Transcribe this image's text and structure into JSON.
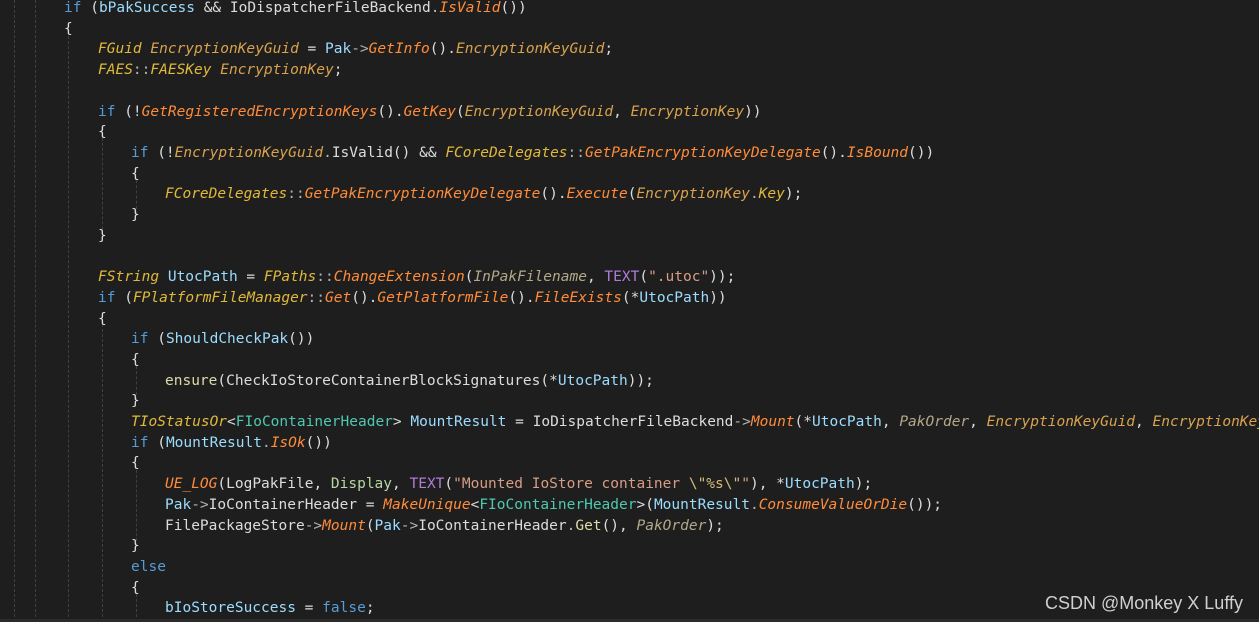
{
  "editor": {
    "lines": [
      {
        "indent": 64,
        "tokens": [
          [
            "kw",
            "if"
          ],
          [
            "plain",
            " ("
          ],
          [
            "var",
            "bPakSuccess"
          ],
          [
            "plain",
            " && "
          ],
          [
            "plain",
            "IoDispatcherFileBackend"
          ],
          [
            "op",
            "."
          ],
          [
            "fn",
            "IsValid"
          ],
          [
            "plain",
            "())"
          ]
        ]
      },
      {
        "indent": 64,
        "tokens": [
          [
            "plain",
            "{"
          ]
        ]
      },
      {
        "indent": 98,
        "tokens": [
          [
            "ty",
            "FGuid"
          ],
          [
            "plain",
            " "
          ],
          [
            "tyi",
            "EncryptionKeyGuid"
          ],
          [
            "plain",
            " = "
          ],
          [
            "var",
            "Pak"
          ],
          [
            "op",
            "->"
          ],
          [
            "fn",
            "GetInfo"
          ],
          [
            "plain",
            "()."
          ],
          [
            "tyi",
            "EncryptionKeyGuid"
          ],
          [
            "plain",
            ";"
          ]
        ]
      },
      {
        "indent": 98,
        "tokens": [
          [
            "ty",
            "FAES"
          ],
          [
            "op",
            "::"
          ],
          [
            "ty",
            "FAESKey"
          ],
          [
            "plain",
            " "
          ],
          [
            "tyi",
            "EncryptionKey"
          ],
          [
            "plain",
            ";"
          ]
        ]
      },
      {
        "indent": 98,
        "tokens": []
      },
      {
        "indent": 98,
        "tokens": [
          [
            "kw",
            "if"
          ],
          [
            "plain",
            " (!"
          ],
          [
            "fn",
            "GetRegisteredEncryptionKeys"
          ],
          [
            "plain",
            "()."
          ],
          [
            "fn",
            "GetKey"
          ],
          [
            "plain",
            "("
          ],
          [
            "tyi",
            "EncryptionKeyGuid"
          ],
          [
            "plain",
            ", "
          ],
          [
            "tyi",
            "EncryptionKey"
          ],
          [
            "plain",
            "))"
          ]
        ]
      },
      {
        "indent": 98,
        "tokens": [
          [
            "plain",
            "{"
          ]
        ]
      },
      {
        "indent": 131,
        "tokens": [
          [
            "kw",
            "if"
          ],
          [
            "plain",
            " (!"
          ],
          [
            "tyi",
            "EncryptionKeyGuid"
          ],
          [
            "op",
            "."
          ],
          [
            "plain",
            "IsValid() && "
          ],
          [
            "ty",
            "FCoreDelegates"
          ],
          [
            "op",
            "::"
          ],
          [
            "fn",
            "GetPakEncryptionKeyDelegate"
          ],
          [
            "plain",
            "()."
          ],
          [
            "fn",
            "IsBound"
          ],
          [
            "plain",
            "())"
          ]
        ]
      },
      {
        "indent": 131,
        "tokens": [
          [
            "plain",
            "{"
          ]
        ]
      },
      {
        "indent": 165,
        "tokens": [
          [
            "ty",
            "FCoreDelegates"
          ],
          [
            "op",
            "::"
          ],
          [
            "fn",
            "GetPakEncryptionKeyDelegate"
          ],
          [
            "plain",
            "()."
          ],
          [
            "fn",
            "Execute"
          ],
          [
            "plain",
            "("
          ],
          [
            "tyi",
            "EncryptionKey"
          ],
          [
            "op",
            "."
          ],
          [
            "ty",
            "Key"
          ],
          [
            "plain",
            ");"
          ]
        ]
      },
      {
        "indent": 131,
        "tokens": [
          [
            "plain",
            "}"
          ]
        ]
      },
      {
        "indent": 98,
        "tokens": [
          [
            "plain",
            "}"
          ]
        ]
      },
      {
        "indent": 98,
        "tokens": []
      },
      {
        "indent": 98,
        "tokens": [
          [
            "ty",
            "FString"
          ],
          [
            "plain",
            " "
          ],
          [
            "var",
            "UtocPath"
          ],
          [
            "plain",
            " = "
          ],
          [
            "ty",
            "FPaths"
          ],
          [
            "op",
            "::"
          ],
          [
            "fn",
            "ChangeExtension"
          ],
          [
            "plain",
            "("
          ],
          [
            "pm",
            "InPakFilename"
          ],
          [
            "plain",
            ", "
          ],
          [
            "mac",
            "TEXT"
          ],
          [
            "plain",
            "("
          ],
          [
            "str",
            "\".utoc\""
          ],
          [
            "plain",
            "));"
          ]
        ]
      },
      {
        "indent": 98,
        "tokens": [
          [
            "kw",
            "if"
          ],
          [
            "plain",
            " ("
          ],
          [
            "ty",
            "FPlatformFileManager"
          ],
          [
            "op",
            "::"
          ],
          [
            "fn",
            "Get"
          ],
          [
            "plain",
            "()."
          ],
          [
            "fn",
            "GetPlatformFile"
          ],
          [
            "plain",
            "()."
          ],
          [
            "fn",
            "FileExists"
          ],
          [
            "plain",
            "(*"
          ],
          [
            "var",
            "UtocPath"
          ],
          [
            "plain",
            "))"
          ]
        ]
      },
      {
        "indent": 98,
        "tokens": [
          [
            "plain",
            "{"
          ]
        ]
      },
      {
        "indent": 131,
        "tokens": [
          [
            "kw",
            "if"
          ],
          [
            "plain",
            " ("
          ],
          [
            "var",
            "ShouldCheckPak"
          ],
          [
            "plain",
            "())"
          ]
        ]
      },
      {
        "indent": 131,
        "tokens": [
          [
            "plain",
            "{"
          ]
        ]
      },
      {
        "indent": 165,
        "tokens": [
          [
            "fnb",
            "ensure"
          ],
          [
            "plain",
            "("
          ],
          [
            "plain",
            "CheckIoStoreContainerBlockSignatures"
          ],
          [
            "plain",
            "(*"
          ],
          [
            "var",
            "UtocPath"
          ],
          [
            "plain",
            "));"
          ]
        ]
      },
      {
        "indent": 131,
        "tokens": [
          [
            "plain",
            "}"
          ]
        ]
      },
      {
        "indent": 131,
        "tokens": [
          [
            "ty",
            "TIoStatusOr"
          ],
          [
            "plain",
            "<"
          ],
          [
            "cls",
            "FIoContainerHeader"
          ],
          [
            "plain",
            "> "
          ],
          [
            "var",
            "MountResult"
          ],
          [
            "plain",
            " = "
          ],
          [
            "plain",
            "IoDispatcherFileBackend"
          ],
          [
            "op",
            "->"
          ],
          [
            "fn",
            "Mount"
          ],
          [
            "plain",
            "(*"
          ],
          [
            "var",
            "UtocPath"
          ],
          [
            "plain",
            ", "
          ],
          [
            "pm",
            "PakOrder"
          ],
          [
            "plain",
            ", "
          ],
          [
            "tyi",
            "EncryptionKeyGuid"
          ],
          [
            "plain",
            ", "
          ],
          [
            "tyi",
            "EncryptionKey"
          ],
          [
            "plain",
            ");"
          ]
        ]
      },
      {
        "indent": 131,
        "tokens": [
          [
            "kw",
            "if"
          ],
          [
            "plain",
            " ("
          ],
          [
            "var",
            "MountResult"
          ],
          [
            "op",
            "."
          ],
          [
            "fn",
            "IsOk"
          ],
          [
            "plain",
            "())"
          ]
        ]
      },
      {
        "indent": 131,
        "tokens": [
          [
            "plain",
            "{"
          ]
        ]
      },
      {
        "indent": 165,
        "tokens": [
          [
            "fn",
            "UE_LOG"
          ],
          [
            "plain",
            "("
          ],
          [
            "plain",
            "LogPakFile"
          ],
          [
            "plain",
            ", "
          ],
          [
            "enum",
            "Display"
          ],
          [
            "plain",
            ", "
          ],
          [
            "mac",
            "TEXT"
          ],
          [
            "plain",
            "("
          ],
          [
            "str",
            "\"Mounted IoStore container "
          ],
          [
            "esc",
            "\\\"%s\\\""
          ],
          [
            "str",
            "\""
          ],
          [
            "plain",
            "), *"
          ],
          [
            "var",
            "UtocPath"
          ],
          [
            "plain",
            ");"
          ]
        ]
      },
      {
        "indent": 165,
        "tokens": [
          [
            "var",
            "Pak"
          ],
          [
            "op",
            "->"
          ],
          [
            "plain",
            "IoContainerHeader"
          ],
          [
            "plain",
            " = "
          ],
          [
            "fn",
            "MakeUnique"
          ],
          [
            "plain",
            "<"
          ],
          [
            "cls",
            "FIoContainerHeader"
          ],
          [
            "plain",
            ">("
          ],
          [
            "var",
            "MountResult"
          ],
          [
            "op",
            "."
          ],
          [
            "fn",
            "ConsumeValueOrDie"
          ],
          [
            "plain",
            "());"
          ]
        ]
      },
      {
        "indent": 165,
        "tokens": [
          [
            "plain",
            "FilePackageStore"
          ],
          [
            "op",
            "->"
          ],
          [
            "fn",
            "Mount"
          ],
          [
            "plain",
            "("
          ],
          [
            "var",
            "Pak"
          ],
          [
            "op",
            "->"
          ],
          [
            "plain",
            "IoContainerHeader"
          ],
          [
            "op",
            "."
          ],
          [
            "fnb",
            "Get"
          ],
          [
            "plain",
            "(), "
          ],
          [
            "pm",
            "PakOrder"
          ],
          [
            "plain",
            ");"
          ]
        ]
      },
      {
        "indent": 131,
        "tokens": [
          [
            "plain",
            "}"
          ]
        ]
      },
      {
        "indent": 131,
        "tokens": [
          [
            "kw",
            "else"
          ]
        ]
      },
      {
        "indent": 131,
        "tokens": [
          [
            "plain",
            "{"
          ]
        ]
      },
      {
        "indent": 165,
        "tokens": [
          [
            "var",
            "bIoStoreSuccess"
          ],
          [
            "plain",
            " = "
          ],
          [
            "kw",
            "false"
          ],
          [
            "plain",
            ";"
          ]
        ]
      }
    ]
  },
  "watermark": {
    "text": "CSDN @Monkey X Luffy"
  }
}
